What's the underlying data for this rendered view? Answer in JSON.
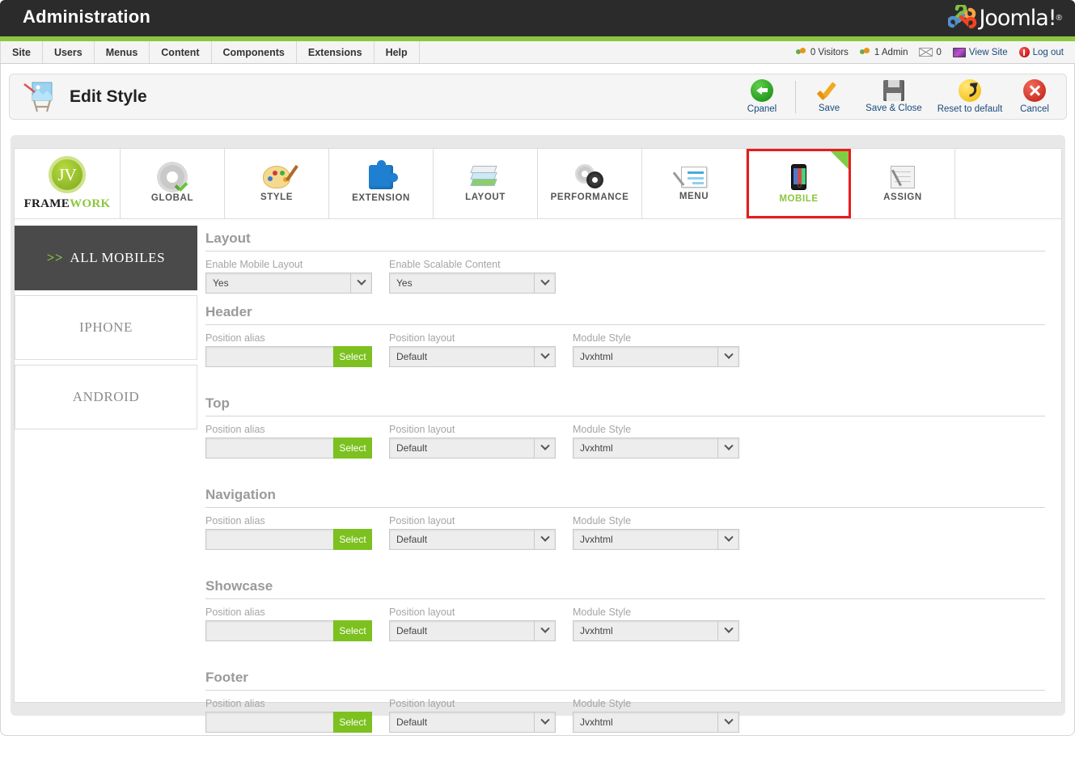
{
  "topbar": {
    "title": "Administration",
    "logo_text": "Joomla!",
    "logo_sup": "®"
  },
  "menubar": {
    "items": [
      {
        "label": "Site"
      },
      {
        "label": "Users"
      },
      {
        "label": "Menus"
      },
      {
        "label": "Content"
      },
      {
        "label": "Components"
      },
      {
        "label": "Extensions"
      },
      {
        "label": "Help"
      }
    ],
    "status": {
      "visitors": "0 Visitors",
      "admins": "1 Admin",
      "messages": "0",
      "view_site": "View Site",
      "logout": "Log out"
    }
  },
  "header": {
    "page_title": "Edit Style",
    "icon": "easel-icon"
  },
  "toolbar": {
    "buttons": [
      {
        "label": "Cpanel",
        "icon": "back-arrow-icon"
      },
      {
        "label": "Save",
        "icon": "checkmark-icon"
      },
      {
        "label": "Save & Close",
        "icon": "floppy-disk-icon"
      },
      {
        "label": "Reset to default",
        "icon": "redo-arrow-icon"
      },
      {
        "label": "Cancel",
        "icon": "close-x-icon"
      }
    ]
  },
  "framework_tabs": {
    "brand": {
      "badge": "JV",
      "word_a": "FRAME",
      "word_b": "WORK"
    },
    "items": [
      {
        "label": "GLOBAL",
        "icon": "gear-check-icon",
        "active": false
      },
      {
        "label": "STYLE",
        "icon": "palette-icon",
        "active": false
      },
      {
        "label": "EXTENSION",
        "icon": "puzzle-icon",
        "active": false
      },
      {
        "label": "LAYOUT",
        "icon": "layers-icon",
        "active": false
      },
      {
        "label": "PERFORMANCE",
        "icon": "gears-icon",
        "active": false
      },
      {
        "label": "MENU",
        "icon": "menu-edit-icon",
        "active": false
      },
      {
        "label": "MOBILE",
        "icon": "mobile-phone-icon",
        "active": true
      },
      {
        "label": "ASSIGN",
        "icon": "assign-pen-icon",
        "active": false
      }
    ]
  },
  "sidebar": {
    "items": [
      {
        "label": "ALL MOBILES",
        "chevron": ">>",
        "active": true
      },
      {
        "label": "IPHONE",
        "chevron": "",
        "active": false
      },
      {
        "label": "ANDROID",
        "chevron": "",
        "active": false
      }
    ]
  },
  "form": {
    "layout_section": {
      "title": "Layout",
      "fields": [
        {
          "label": "Enable Mobile Layout",
          "value": "Yes"
        },
        {
          "label": "Enable Scalable Content",
          "value": "Yes"
        }
      ]
    },
    "position_sections": [
      {
        "title": "Header",
        "alias_label": "Position alias",
        "alias_value": "",
        "select_button": "Select",
        "layout_label": "Position layout",
        "layout_value": "Default",
        "style_label": "Module Style",
        "style_value": "Jvxhtml"
      },
      {
        "title": "Top",
        "alias_label": "Position alias",
        "alias_value": "",
        "select_button": "Select",
        "layout_label": "Position layout",
        "layout_value": "Default",
        "style_label": "Module Style",
        "style_value": "Jvxhtml"
      },
      {
        "title": "Navigation",
        "alias_label": "Position alias",
        "alias_value": "",
        "select_button": "Select",
        "layout_label": "Position layout",
        "layout_value": "Default",
        "style_label": "Module Style",
        "style_value": "Jvxhtml"
      },
      {
        "title": "Showcase",
        "alias_label": "Position alias",
        "alias_value": "",
        "select_button": "Select",
        "layout_label": "Position layout",
        "layout_value": "Default",
        "style_label": "Module Style",
        "style_value": "Jvxhtml"
      },
      {
        "title": "Footer",
        "alias_label": "Position alias",
        "alias_value": "",
        "select_button": "Select",
        "layout_label": "Position layout",
        "layout_value": "Default",
        "style_label": "Module Style",
        "style_value": "Jvxhtml"
      }
    ]
  },
  "colors": {
    "accent_green": "#8cc63e",
    "select_green": "#7cc11f",
    "active_red": "#e81c1c",
    "dark_header": "#2b2b2b",
    "sidebar_active": "#4a4a4a",
    "link_blue": "#1a4a7a"
  }
}
